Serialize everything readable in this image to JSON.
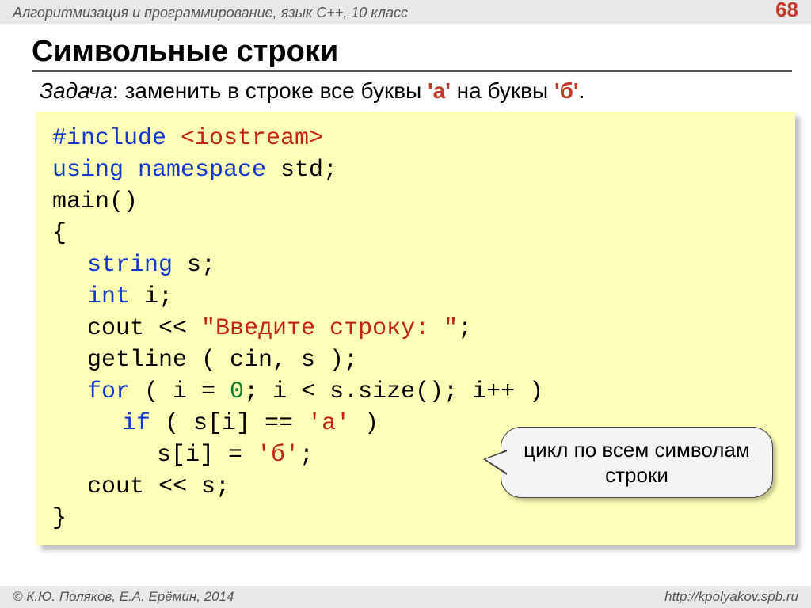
{
  "header": {
    "breadcrumb": "Алгоритмизация и программирование, язык C++, 10 класс",
    "page_number": "68"
  },
  "title": "Символьные строки",
  "task": {
    "label": "Задача",
    "text_before": ": заменить в строке все буквы ",
    "lit_a": "'а'",
    "text_mid": " на буквы ",
    "lit_b": "'б'",
    "text_end": "."
  },
  "code": {
    "include": "#include",
    "iostream": " <iostream>",
    "using": "using",
    "namespace": " namespace",
    "std": " std;",
    "main": "main()",
    "brace_open": "{",
    "string_kw": "string",
    "string_rest": " s;",
    "int_kw": "int",
    "int_rest": " i;",
    "cout1a": "cout << ",
    "cout1b": "\"Введите строку: \"",
    "cout1c": ";",
    "getline": "getline ( cin, s );",
    "for_kw": "for",
    "for_rest1": " ( i = ",
    "zero": "0",
    "for_rest2": "; i < s.size(); i++ )",
    "if_kw": "if",
    "if_rest": " ( s[i] == ",
    "char_a": "'а'",
    "if_close": " )",
    "assign1": "s[i] = ",
    "char_b": "'б'",
    "assign2": ";",
    "cout2": "cout << s;",
    "brace_close": "}"
  },
  "callout": "цикл по всем символам строки",
  "footer": {
    "left": "© К.Ю. Поляков, Е.А. Ерёмин, 2014",
    "right": "http://kpolyakov.spb.ru"
  }
}
